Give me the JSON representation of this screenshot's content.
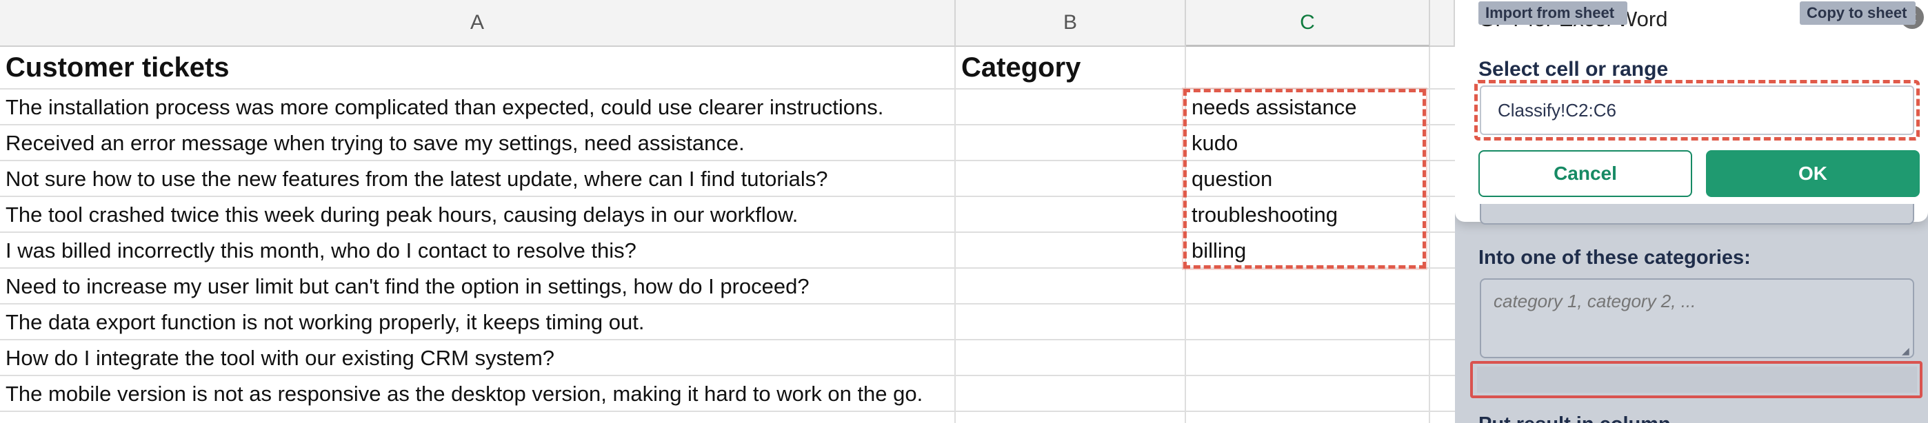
{
  "sheet": {
    "columns": [
      "A",
      "B",
      "C"
    ],
    "active_column": "C",
    "header_row": {
      "a": "Customer tickets",
      "b": "Category",
      "c": ""
    },
    "rows": [
      {
        "a": "The installation process was more complicated than expected, could use clearer instructions.",
        "c": "needs assistance"
      },
      {
        "a": "Received an error message when trying to save my settings, need assistance.",
        "c": "kudo"
      },
      {
        "a": "Not sure how to use the new features from the latest update, where can I find tutorials?",
        "c": "question"
      },
      {
        "a": "The tool crashed twice this week during peak hours, causing delays in our workflow.",
        "c": "troubleshooting"
      },
      {
        "a": "I was billed incorrectly this month, who do I contact to resolve this?",
        "c": "billing"
      },
      {
        "a": "Need to increase my user limit but can't find the option in settings, how do I proceed?",
        "c": ""
      },
      {
        "a": "The data export function is not working properly, it keeps timing out.",
        "c": ""
      },
      {
        "a": "How do I integrate the tool with our existing CRM system?",
        "c": ""
      },
      {
        "a": "The mobile version is not as responsive as the desktop version, making it hard to work on the go.",
        "c": ""
      }
    ]
  },
  "panel": {
    "title": "GPT for Excel Word",
    "close_icon": "close-icon",
    "range_label": "Select cell or range",
    "range_value": "Classify!C2:C6",
    "cancel_label": "Cancel",
    "ok_label": "OK",
    "categories_label": "Into one of these categories:",
    "categories_placeholder": "category 1, category 2, ...",
    "import_label": "Import from sheet",
    "copy_label": "Copy to sheet",
    "cut_label": "Put result in column"
  },
  "colors": {
    "highlight_red": "#e05a4a",
    "ok_green": "#1f9a70",
    "active_column_green": "#0f7b3e",
    "panel_bg": "#cbd0d8"
  }
}
